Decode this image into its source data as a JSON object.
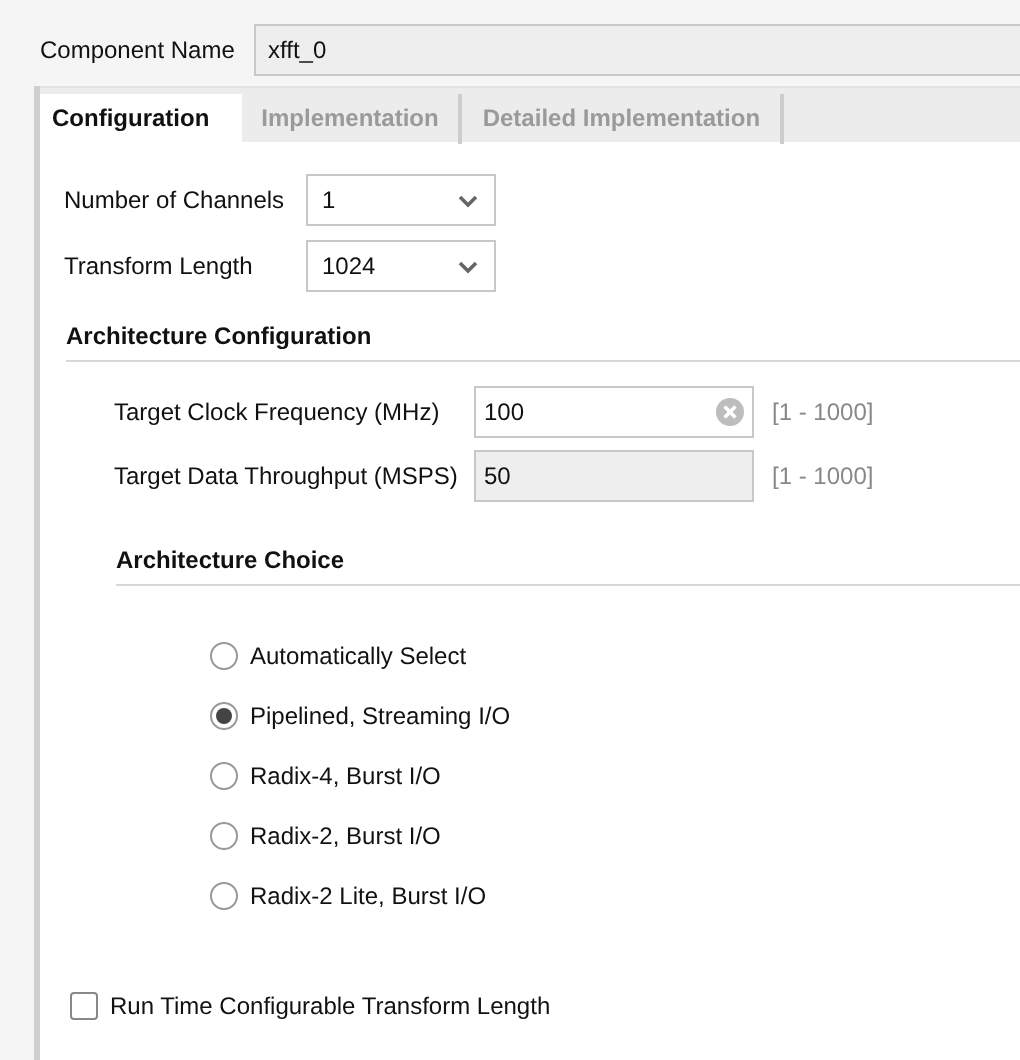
{
  "component_name": {
    "label": "Component Name",
    "value": "xfft_0"
  },
  "tabs": [
    {
      "label": "Configuration",
      "selected": true
    },
    {
      "label": "Implementation",
      "selected": false
    },
    {
      "label": "Detailed Implementation",
      "selected": false
    }
  ],
  "fields": [
    {
      "label": "Number of Channels",
      "value": "1"
    },
    {
      "label": "Transform Length",
      "value": "1024"
    }
  ],
  "architecture_configuration": {
    "title": "Architecture Configuration",
    "fields": [
      {
        "label": "Target Clock Frequency (MHz)",
        "value": "100",
        "disabled": false,
        "range": "[1 - 1000]"
      },
      {
        "label": "Target Data Throughput (MSPS)",
        "value": "50",
        "disabled": true,
        "range": "[1 - 1000]"
      }
    ],
    "architecture_choice": {
      "title": "Architecture Choice",
      "options": [
        {
          "label": "Automatically Select",
          "selected": false
        },
        {
          "label": "Pipelined, Streaming I/O",
          "selected": true
        },
        {
          "label": "Radix-4, Burst I/O",
          "selected": false
        },
        {
          "label": "Radix-2, Burst I/O",
          "selected": false
        },
        {
          "label": "Radix-2 Lite, Burst I/O",
          "selected": false
        }
      ]
    }
  },
  "run_time_option": {
    "label": "Run Time Configurable Transform Length",
    "checked": false
  }
}
